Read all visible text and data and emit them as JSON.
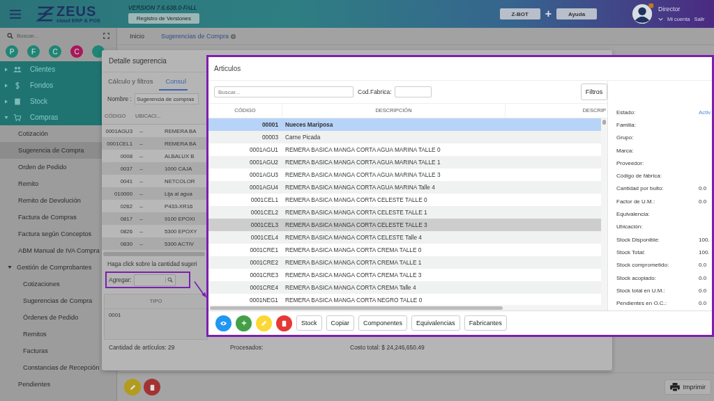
{
  "header": {
    "logo_text": "ZEUS",
    "logo_tagline": "cloud ERP & POS",
    "version": "VERSION 7.6.638.0-FALL",
    "versions_button": "Registro de Versiones",
    "zbot_button": "Z-BOT",
    "plus_sign": "+",
    "help_button": "Ayuda",
    "user_name": "Director",
    "account_link": "Mi cuenta",
    "logout_link": "Salir"
  },
  "sidebar": {
    "search_placeholder": "Buscar...",
    "shortcuts": [
      {
        "letter": "P",
        "color": "#1f8574"
      },
      {
        "letter": "F",
        "color": "#1f8574"
      },
      {
        "letter": "C",
        "color": "#1f8574"
      },
      {
        "letter": "C",
        "color": "#a8185a"
      },
      {
        "color": "#1f8574"
      }
    ],
    "modules": [
      {
        "label": "Clientes",
        "kind": "people",
        "expanded": false
      },
      {
        "label": "Fondos",
        "kind": "dollar",
        "expanded": false
      },
      {
        "label": "Stock",
        "kind": "box",
        "expanded": false
      },
      {
        "label": "Compras",
        "kind": "cart",
        "expanded": true,
        "children": [
          {
            "label": "Cotización",
            "selected": false
          },
          {
            "label": "Sugerencia de Compra",
            "selected": true
          },
          {
            "label": "Orden de Pedido",
            "selected": false
          },
          {
            "label": "Remito",
            "selected": false
          },
          {
            "label": "Remito de Devolución",
            "selected": false
          },
          {
            "label": "Factura de Compras",
            "selected": false
          },
          {
            "label": "Factura según Conceptos",
            "selected": false
          },
          {
            "label": "ABM Manual de IVA Compra",
            "selected": false
          },
          {
            "label": "Gestión de Comprobantes",
            "selected": false,
            "expanded": true,
            "children": [
              {
                "label": "Cotizaciones",
                "selected": false
              },
              {
                "label": "Sugerencias de Compra",
                "selected": false
              },
              {
                "label": "Órdenes de Pedido",
                "selected": false
              },
              {
                "label": "Remitos",
                "selected": false
              },
              {
                "label": "Facturas",
                "selected": false
              },
              {
                "label": "Constancias de Recepción",
                "selected": false
              }
            ]
          },
          {
            "label": "Pendientes",
            "selected": false
          }
        ]
      }
    ]
  },
  "page_tabs": [
    {
      "label": "Inicio",
      "selected": false,
      "closable": false
    },
    {
      "label": "Sugerencias de Compra",
      "selected": true,
      "closable": true
    }
  ],
  "page_actions": {
    "icon_actions": [
      {
        "kind": "edit"
      },
      {
        "kind": "delete"
      }
    ],
    "print_button": "Imprimir"
  },
  "detail_dialog": {
    "title": "Detalle sugerencia",
    "tabs": [
      {
        "label": "Cálculo y filtros",
        "selected": false
      },
      {
        "label": "Consul",
        "selected": true
      }
    ],
    "name_label": "Nombre :",
    "name_value": "Sugerencia de compras",
    "columns": [
      "CÓDIGO",
      "UBICACI..."
    ],
    "rows": [
      {
        "code": "0001AGU3",
        "location": "--",
        "description": "REMERA BA"
      },
      {
        "code": "0001CEL1",
        "location": "--",
        "description": "REMERA BA"
      },
      {
        "code": "0008",
        "location": "--",
        "description": "ALBALUX B"
      },
      {
        "code": "0037",
        "location": "--",
        "description": "1000 CAJA"
      },
      {
        "code": "0041",
        "location": "--",
        "description": "NETCOLOR"
      },
      {
        "code": "010000",
        "location": "--",
        "description": "Lija al agua"
      },
      {
        "code": "0262",
        "location": "--",
        "description": "P433-XR16"
      },
      {
        "code": "0817",
        "location": "--",
        "description": "9100 EPOXI"
      },
      {
        "code": "0826",
        "location": "--",
        "description": "5300 EPOXY"
      },
      {
        "code": "0830",
        "location": "--",
        "description": "5300 ACTIV"
      }
    ],
    "hint": "Haga click sobre la cantidad sugeri",
    "add_label": "Agregar:",
    "lines_columns": [
      "TIPO"
    ],
    "lines_rows": [
      [
        "0001"
      ]
    ],
    "footer": {
      "count": "Cantidad de artículos: 29",
      "processed": "Procesados:",
      "total": "Costo total: $ 24,246,650.49"
    }
  },
  "articles_dialog": {
    "title": "Articulos",
    "search_placeholder": "Buscar...",
    "factory_code_label": "Cod.Fabrica:",
    "filters_button": "Filtros",
    "columns": [
      "CÓDIGO",
      "DESCRIPCIÓN",
      "DESCRIP"
    ],
    "rows": [
      {
        "code": "00001",
        "description": "Nueces Mariposa",
        "selected": true,
        "hovered": false
      },
      {
        "code": "00003",
        "description": "Carne Picada",
        "selected": false,
        "hovered": false
      },
      {
        "code": "0001AGU1",
        "description": "REMERA BASICA MANGA CORTA AGUA MARINA TALLE 0",
        "selected": false,
        "hovered": false
      },
      {
        "code": "0001AGU2",
        "description": "REMERA BASICA MANGA CORTA AGUA MARINA TALLE 1",
        "selected": false,
        "hovered": false
      },
      {
        "code": "0001AGU3",
        "description": "REMERA BASICA MANGA CORTA AGUA MARINA TALLE 3",
        "selected": false,
        "hovered": false
      },
      {
        "code": "0001AGU4",
        "description": "REMERA BASICA MANGA CORTA AGUA MARINA Talle 4",
        "selected": false,
        "hovered": false
      },
      {
        "code": "0001CEL1",
        "description": "REMERA BASICA MANGA CORTA CELESTE TALLE 0",
        "selected": false,
        "hovered": false
      },
      {
        "code": "0001CEL2",
        "description": "REMERA BASICA MANGA CORTA CELESTE TALLE 1",
        "selected": false,
        "hovered": false
      },
      {
        "code": "0001CEL3",
        "description": "REMERA BASICA MANGA CORTA CELESTE TALLE 3",
        "selected": false,
        "hovered": true
      },
      {
        "code": "0001CEL4",
        "description": "REMERA BASICA MANGA CORTA CELESTE Talle 4",
        "selected": false,
        "hovered": false
      },
      {
        "code": "0001CRE1",
        "description": "REMERA BASICA MANGA CORTA CREMA TALLE 0",
        "selected": false,
        "hovered": false
      },
      {
        "code": "0001CRE2",
        "description": "REMERA BASICA MANGA CORTA CREMA TALLE 1",
        "selected": false,
        "hovered": false
      },
      {
        "code": "0001CRE3",
        "description": "REMERA BASICA MANGA CORTA CREMA TALLE 3",
        "selected": false,
        "hovered": false
      },
      {
        "code": "0001CRE4",
        "description": "REMERA BASICA MANGA CORTA CREMA Talle 4",
        "selected": false,
        "hovered": false
      },
      {
        "code": "0001NEG1",
        "description": "REMERA BASICA MANGA CORTA NEGRO TALLE 0",
        "selected": false,
        "hovered": false
      }
    ],
    "details": [
      {
        "label": "Estado:",
        "value": "Activ",
        "kind": "status"
      },
      {
        "label": "Familia:"
      },
      {
        "label": "Grupo:"
      },
      {
        "label": "Marca:"
      },
      {
        "label": "Proveedor:"
      },
      {
        "label": "Código de fábrica:"
      },
      {
        "label": "Cantidad por bulto:",
        "value": "0.0",
        "kind": "number"
      },
      {
        "label": "Factor de U.M.:",
        "value": "0.0",
        "kind": "number"
      },
      {
        "label": "Equivalencia:"
      },
      {
        "label": "Ubicación:"
      },
      {
        "label": "Stock Disponible:",
        "value": "100.",
        "kind": "number"
      },
      {
        "label": "Stock Total:",
        "value": "100.",
        "kind": "number"
      },
      {
        "label": "Stock comprometido:",
        "value": "0.0",
        "kind": "number"
      },
      {
        "label": "Stock acopiado:",
        "value": "0.0",
        "kind": "number"
      },
      {
        "label": "Stock total en U.M.:",
        "value": "0.0",
        "kind": "number"
      },
      {
        "label": "Pendientes en O.C.:",
        "value": "0.0",
        "kind": "number"
      }
    ],
    "icon_actions": [
      {
        "kind": "view"
      },
      {
        "kind": "add"
      },
      {
        "kind": "edit"
      },
      {
        "kind": "delete"
      }
    ],
    "text_actions": [
      "Stock",
      "Copiar",
      "Componentes",
      "Equivalencias",
      "Fabricantes"
    ]
  }
}
